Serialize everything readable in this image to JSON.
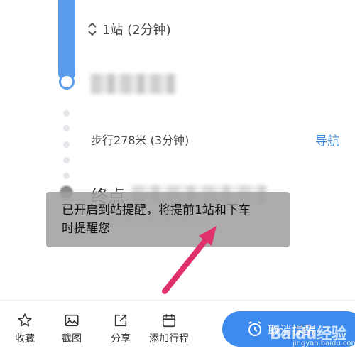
{
  "route": {
    "stop_count_text": "1站 (2分钟)",
    "walk_text": "步行278米 (3分钟)",
    "nav_label": "导航",
    "destination_label": "终点"
  },
  "toast": {
    "message_line1": "已开启到站提醒，将提前1站和下车",
    "message_line2": "时提醒您"
  },
  "toolbar": {
    "favorite_label": "收藏",
    "screenshot_label": "截图",
    "share_label": "分享",
    "add_trip_label": "添加行程",
    "cancel_label": "取消提醒"
  },
  "watermark": {
    "brand": "Baidu经验",
    "url": "jingyan.baidu.com"
  },
  "colors": {
    "route_blue": "#5b9ded",
    "link_blue": "#3c87d8",
    "button_blue": "#3d8bef",
    "arrow_pink": "#e0306d",
    "toast_gray": "#a0a0a0"
  }
}
